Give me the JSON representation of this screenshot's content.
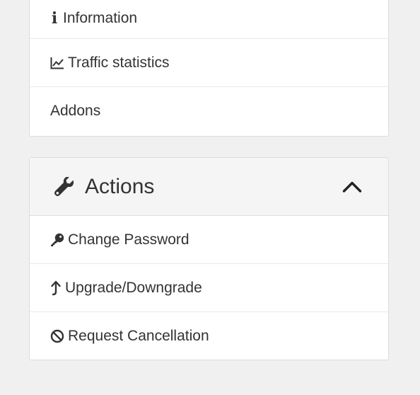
{
  "overview_menu": {
    "items": [
      {
        "label": "Information",
        "icon": "info-icon"
      },
      {
        "label": "Traffic statistics",
        "icon": "line-chart-icon"
      },
      {
        "label": "Addons",
        "icon": ""
      }
    ]
  },
  "actions_panel": {
    "title": "Actions",
    "header_icon": "wrench-icon",
    "toggle_icon": "chevron-up-icon",
    "items": [
      {
        "label": "Change Password",
        "icon": "key-icon"
      },
      {
        "label": "Upgrade/Downgrade",
        "icon": "arrow-up-icon"
      },
      {
        "label": "Request Cancellation",
        "icon": "ban-icon"
      }
    ]
  },
  "colors": {
    "page_background": "#f0f0f0",
    "panel_background": "#ffffff",
    "panel_header_background": "#f5f5f5",
    "border": "#dddddd",
    "text": "#333333"
  }
}
